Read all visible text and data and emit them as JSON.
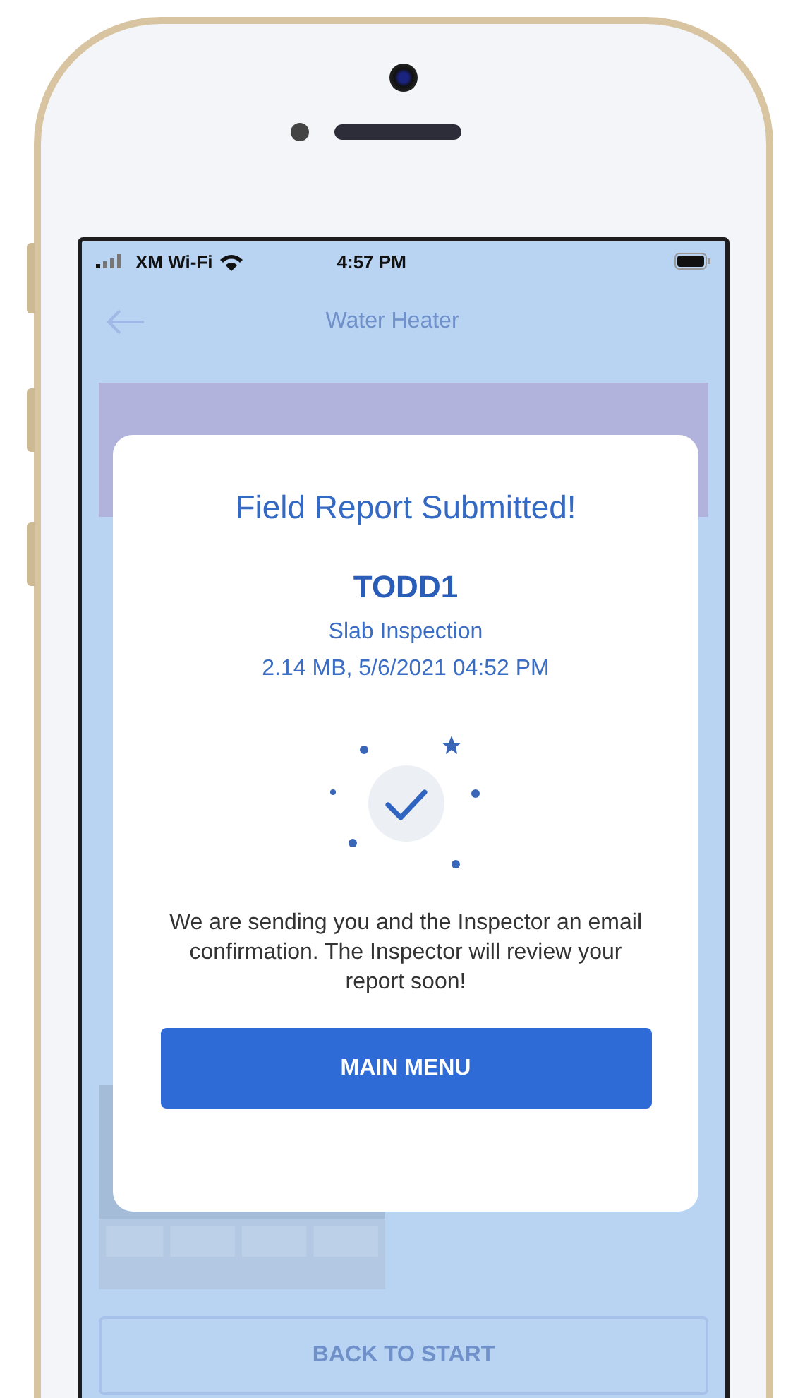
{
  "status_bar": {
    "carrier": "XM Wi-Fi",
    "time": "4:57 PM"
  },
  "header": {
    "title": "Water Heater"
  },
  "dialog": {
    "title": "Field Report Submitted!",
    "report_name": "TODD1",
    "report_type": "Slab Inspection",
    "details": "2.14 MB, 5/6/2021 04:52 PM",
    "message": "We are sending you and the Inspector an email confirmation. The Inspector will review your report soon!",
    "button": "MAIN MENU"
  },
  "footer_button": {
    "label": "BACK TO START"
  }
}
